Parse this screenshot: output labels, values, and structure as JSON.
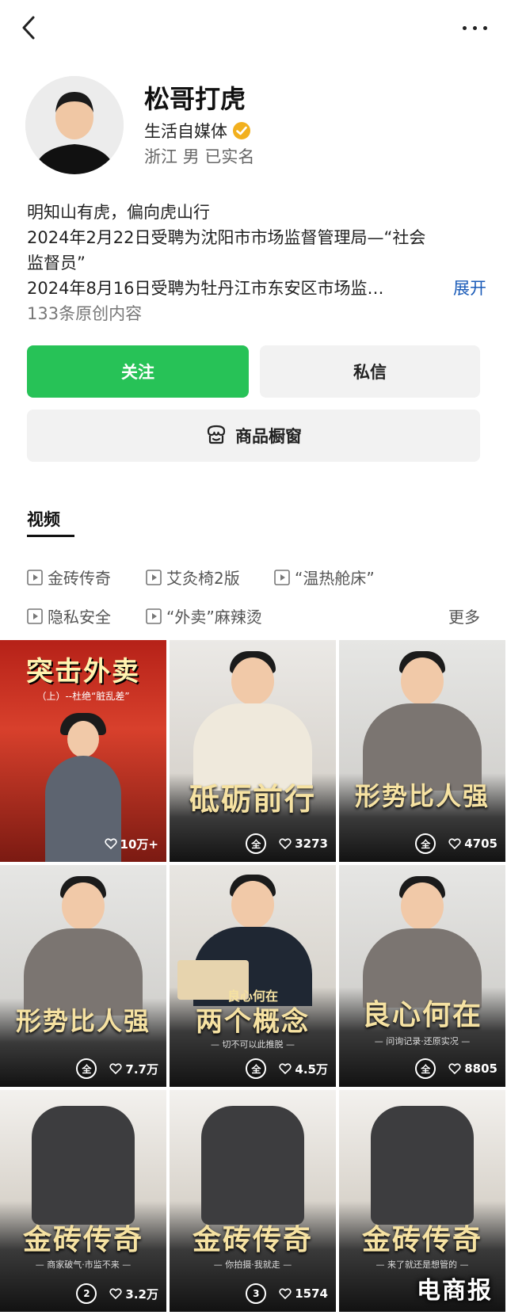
{
  "profile": {
    "name": "松哥打虎",
    "type": "生活自媒体",
    "meta": "浙江 男 已实名",
    "bio_line1": "明知山有虎，偏向虎山行",
    "bio_line2": "2024年2月22日受聘为沈阳市市场监督管理局—“社会",
    "bio_line3": "监督员”",
    "bio_line4": "2024年8月16日受聘为牡丹江市东安区市场监…",
    "expand": "展开",
    "count": "133条原创内容"
  },
  "actions": {
    "follow": "关注",
    "message": "私信",
    "shop": "商品橱窗"
  },
  "tabs": {
    "video": "视频"
  },
  "collections": [
    "金砖传奇",
    "艾灸椅2版",
    "“温热舱床”",
    "隐私安全",
    "“外卖”麻辣烫"
  ],
  "more": "更多",
  "videos": [
    {
      "title_top": "突击外卖",
      "subtitle": "（上）--杜绝“脏乱差”",
      "title": "",
      "badge": "",
      "likes": "10万+"
    },
    {
      "title": "砥砺前行",
      "subtitle": "",
      "badge": "全",
      "likes": "3273"
    },
    {
      "title": "形势比人强",
      "subtitle": "",
      "badge": "全",
      "likes": "4705"
    },
    {
      "title": "形势比人强",
      "subtitle": "",
      "badge": "全",
      "likes": "7.7万"
    },
    {
      "title_top": "良心何在",
      "title": "两个概念",
      "subtitle": "— 切不可以此推脱 —",
      "badge": "全",
      "likes": "4.5万"
    },
    {
      "title": "良心何在",
      "subtitle": "— 问询记录·还原实况 —",
      "badge": "全",
      "likes": "8805"
    },
    {
      "title": "金砖传奇",
      "subtitle": "— 商家破气·市监不来 —",
      "badge": "2",
      "likes": "3.2万"
    },
    {
      "title": "金砖传奇",
      "subtitle": "— 你拍摄·我就走 —",
      "badge": "3",
      "likes": "1574"
    },
    {
      "title": "金砖传奇",
      "subtitle": "— 来了就还是想管的 —",
      "badge": "",
      "likes": ""
    }
  ],
  "watermark": "电商报",
  "colors": {
    "follow_green": "#27c257",
    "expand_blue": "#1a5bb8",
    "verified_gold": "#f2b01e"
  }
}
